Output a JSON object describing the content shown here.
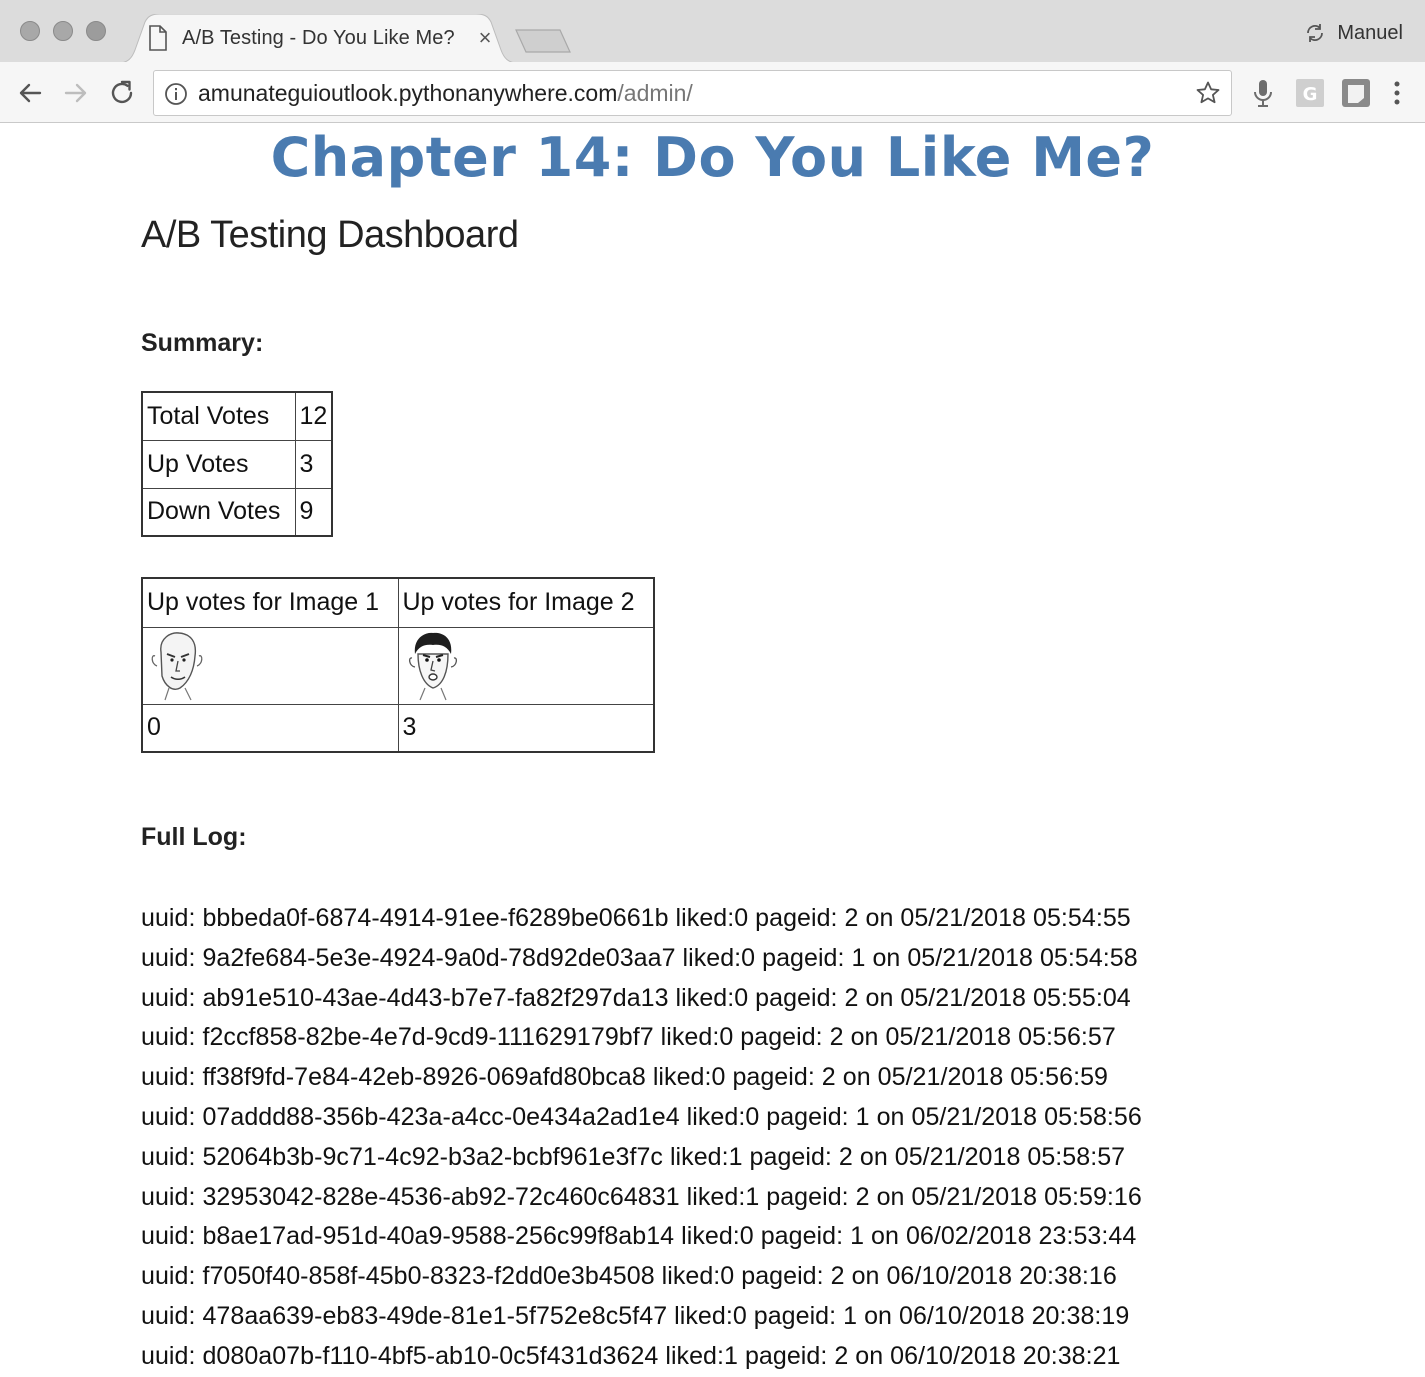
{
  "browser": {
    "tab_title": "A/B Testing - Do You Like Me?",
    "tab_close": "×",
    "profile_name": "Manuel",
    "url_host": "amunateguioutlook.pythonanywhere.com",
    "url_path": "/admin/",
    "icons": [
      "back-arrow-icon",
      "forward-arrow-icon",
      "reload-icon",
      "info-icon",
      "star-icon",
      "microphone-icon",
      "g-extension-icon",
      "square-extension-icon",
      "menu-dots-icon",
      "document-icon",
      "sync-icon"
    ]
  },
  "page": {
    "chapter_title": "Chapter 14: Do You Like Me?",
    "dashboard_title": "A/B Testing Dashboard",
    "summary_label": "Summary:",
    "summary": [
      {
        "label": "Total Votes",
        "value": "12"
      },
      {
        "label": "Up Votes",
        "value": "3"
      },
      {
        "label": "Down Votes",
        "value": "9"
      }
    ],
    "images_table": {
      "headers": [
        "Up votes for Image 1",
        "Up votes for Image 2"
      ],
      "counts": [
        "0",
        "3"
      ]
    },
    "log_label": "Full Log:",
    "log": [
      "uuid: bbbeda0f-6874-4914-91ee-f6289be0661b liked:0 pageid: 2 on 05/21/2018 05:54:55",
      "uuid: 9a2fe684-5e3e-4924-9a0d-78d92de03aa7 liked:0 pageid: 1 on 05/21/2018 05:54:58",
      "uuid: ab91e510-43ae-4d43-b7e7-fa82f297da13 liked:0 pageid: 2 on 05/21/2018 05:55:04",
      "uuid: f2ccf858-82be-4e7d-9cd9-111629179bf7 liked:0 pageid: 2 on 05/21/2018 05:56:57",
      "uuid: ff38f9fd-7e84-42eb-8926-069afd80bca8 liked:0 pageid: 2 on 05/21/2018 05:56:59",
      "uuid: 07addd88-356b-423a-a4cc-0e434a2ad1e4 liked:0 pageid: 1 on 05/21/2018 05:58:56",
      "uuid: 52064b3b-9c71-4c92-b3a2-bcbf961e3f7c liked:1 pageid: 2 on 05/21/2018 05:58:57",
      "uuid: 32953042-828e-4536-ab92-72c460c64831 liked:1 pageid: 2 on 05/21/2018 05:59:16",
      "uuid: b8ae17ad-951d-40a9-9588-256c99f8ab14 liked:0 pageid: 1 on 06/02/2018 23:53:44",
      "uuid: f7050f40-858f-45b0-8323-f2dd0e3b4508 liked:0 pageid: 2 on 06/10/2018 20:38:16",
      "uuid: 478aa639-eb83-49de-81e1-5f752e8c5f47 liked:0 pageid: 1 on 06/10/2018 20:38:19",
      "uuid: d080a07b-f110-4bf5-ab10-0c5f431d3624 liked:1 pageid: 2 on 06/10/2018 20:38:21"
    ]
  }
}
